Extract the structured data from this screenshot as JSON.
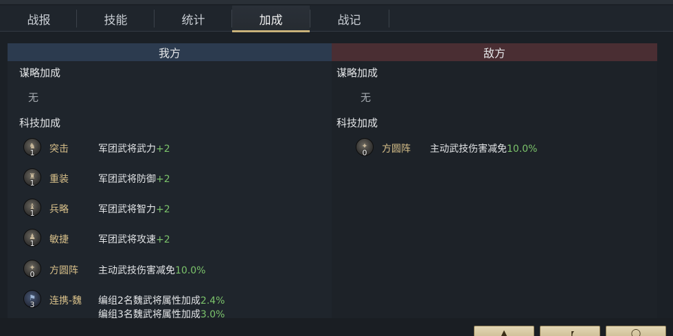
{
  "tabs": [
    {
      "label": "战报"
    },
    {
      "label": "技能"
    },
    {
      "label": "统计"
    },
    {
      "label": "加成"
    },
    {
      "label": "战记"
    }
  ],
  "active_tab": "加成",
  "our_side": {
    "header": "我方",
    "strategy_title": "谋略加成",
    "strategy_none": "无",
    "tech_title": "科技加成",
    "techs": [
      {
        "icon": "cavalry-charge-icon",
        "level": "1",
        "name": "突击",
        "desc": "军团武将武力",
        "value": "+2"
      },
      {
        "icon": "heavy-armor-icon",
        "level": "1",
        "name": "重装",
        "desc": "军团武将防御",
        "value": "+2"
      },
      {
        "icon": "strategy-icon",
        "level": "1",
        "name": "兵略",
        "desc": "军团武将智力",
        "value": "+2"
      },
      {
        "icon": "agility-icon",
        "level": "1",
        "name": "敏捷",
        "desc": "军团武将攻速",
        "value": "+2"
      },
      {
        "icon": "square-formation-icon",
        "level": "0",
        "name": "方圆阵",
        "desc": "主动武技伤害减免",
        "value": "10.0%"
      },
      {
        "icon": "wei-alliance-icon",
        "level": "3",
        "name": "连携-魏",
        "desc": "编组2名魏武将属性加成",
        "value": "2.4%",
        "desc2": "编组3名魏武将属性加成",
        "value2": "3.0%"
      }
    ]
  },
  "enemy_side": {
    "header": "敌方",
    "strategy_title": "谋略加成",
    "strategy_none": "无",
    "tech_title": "科技加成",
    "techs": [
      {
        "icon": "square-formation-icon",
        "level": "0",
        "name": "方圆阵",
        "desc": "主动武技伤害减免",
        "value": "10.0%"
      }
    ]
  },
  "colors": {
    "ally_header": "#2c3b4f",
    "enemy_header": "#4a2e33",
    "tech_name": "#d8c08a",
    "bonus_value": "#7cc46b",
    "active_tab_underline": "#c9b27a"
  }
}
